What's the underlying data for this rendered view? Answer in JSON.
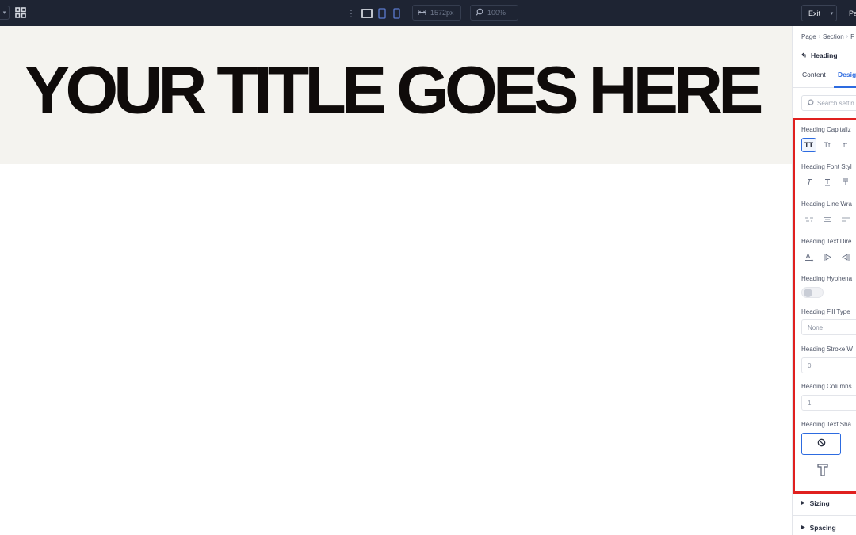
{
  "topbar": {
    "width_value": "1572px",
    "zoom_value": "100%",
    "exit_label": "Exit",
    "publish_label": "Pa"
  },
  "canvas": {
    "hero_title": "YOUR TITLE GOES HERE"
  },
  "panel": {
    "breadcrumb": [
      "Page",
      "Section",
      "F"
    ],
    "element_title": "Heading",
    "tabs": [
      {
        "label": "Content"
      },
      {
        "label": "Desig"
      }
    ],
    "search_placeholder": "Search settin",
    "groups": {
      "capitalization": {
        "label": "Heading Capitaliz",
        "options": [
          "TT",
          "Tt",
          "tt"
        ]
      },
      "font_style": {
        "label": "Heading Font Styl"
      },
      "line_wrap": {
        "label": "Heading Line Wra"
      },
      "text_direction": {
        "label": "Heading Text Dire"
      },
      "hyphenation": {
        "label": "Heading Hyphena"
      },
      "fill_type": {
        "label": "Heading Fill Type",
        "value": "None"
      },
      "stroke_width": {
        "label": "Heading Stroke W",
        "value": "0"
      },
      "columns": {
        "label": "Heading Columns",
        "value": "1"
      },
      "text_shadow": {
        "label": "Heading Text Sha"
      }
    },
    "sections": [
      {
        "label": "Sizing"
      },
      {
        "label": "Spacing"
      }
    ]
  },
  "colors": {
    "accent": "#2d6be0",
    "highlight": "#e0201f",
    "topbar": "#1e2433",
    "hero_bg": "#f4f3ef"
  }
}
